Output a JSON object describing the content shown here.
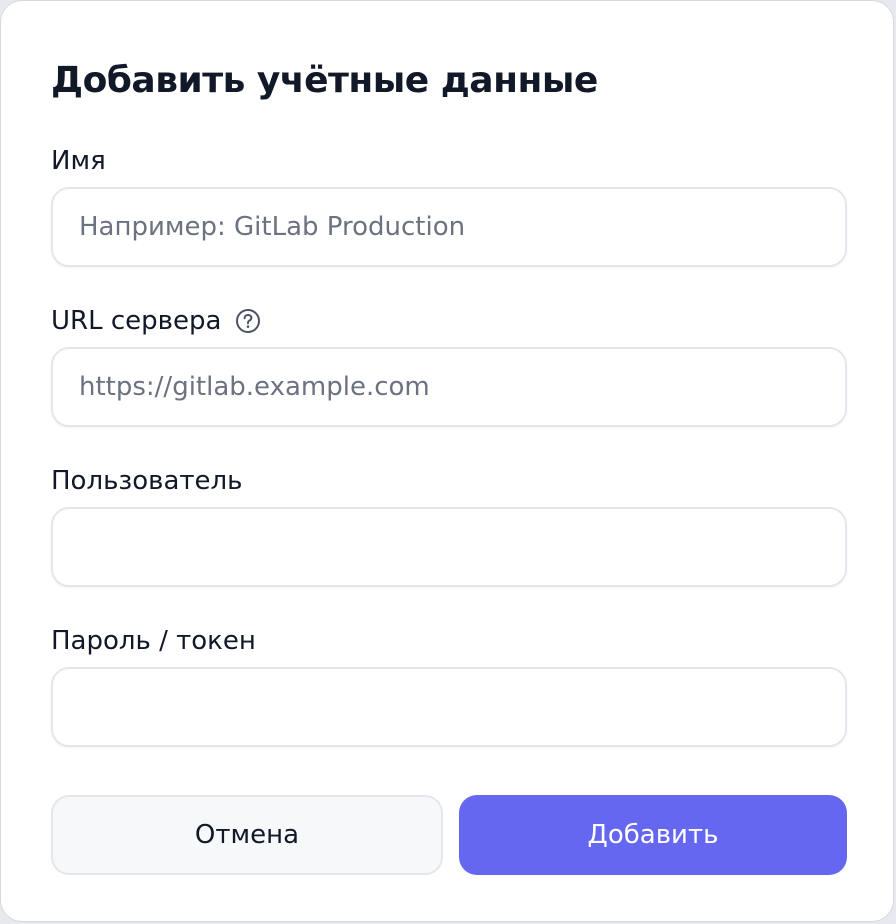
{
  "dialog": {
    "title": "Добавить учётные данные"
  },
  "fields": {
    "name": {
      "label": "Имя",
      "placeholder": "Например: GitLab Production",
      "value": ""
    },
    "server_url": {
      "label": "URL сервера",
      "placeholder": "https://gitlab.example.com",
      "value": "",
      "help_icon": "help-circle-icon"
    },
    "username": {
      "label": "Пользователь",
      "placeholder": "",
      "value": ""
    },
    "password": {
      "label": "Пароль / токен",
      "placeholder": "",
      "value": ""
    }
  },
  "actions": {
    "cancel_label": "Отмена",
    "add_label": "Добавить"
  },
  "colors": {
    "primary": "#6567f1",
    "text": "#111827",
    "placeholder": "#6b7280",
    "border": "#e3e6ec"
  }
}
